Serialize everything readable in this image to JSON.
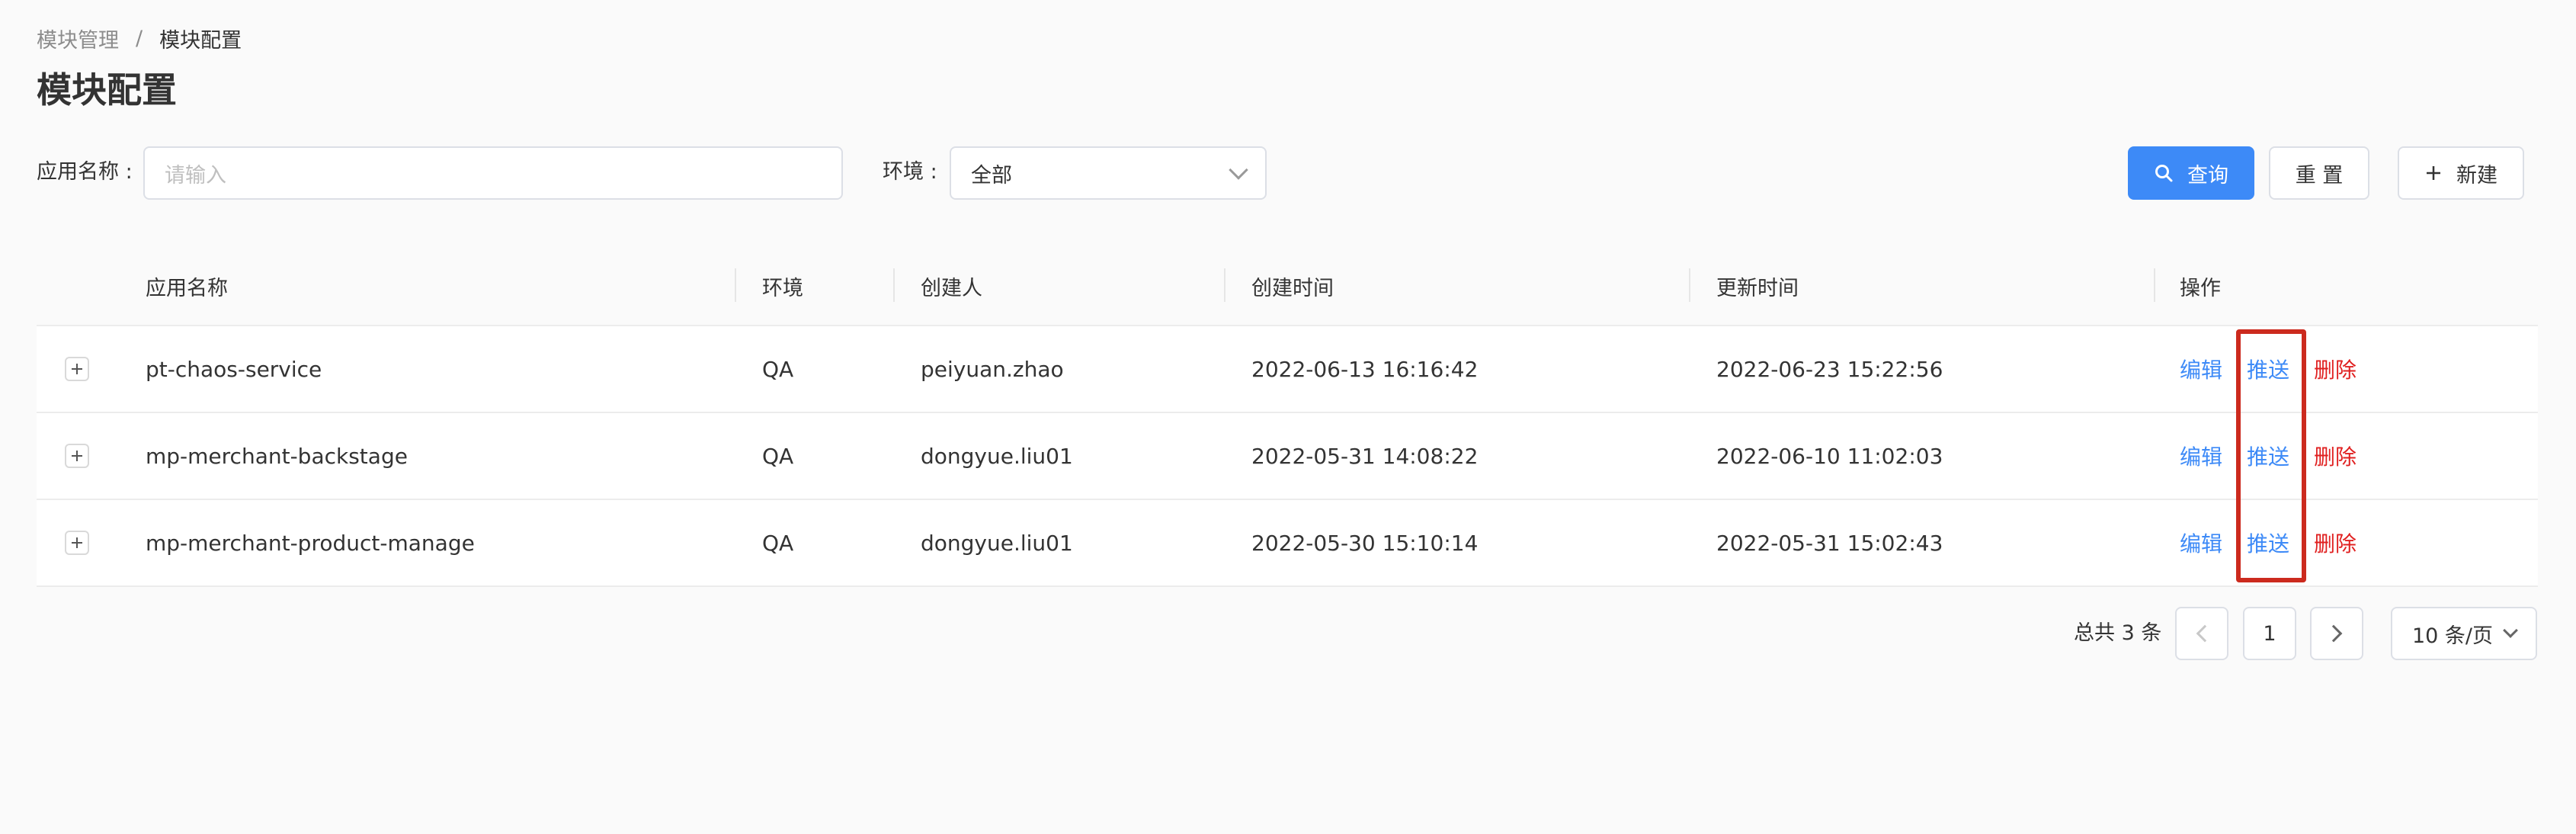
{
  "breadcrumb": {
    "parent": "模块管理",
    "separator": "/",
    "current": "模块配置"
  },
  "page": {
    "title": "模块配置"
  },
  "filters": {
    "app_name_label": "应用名称 :",
    "app_name_placeholder": "请输入",
    "env_label": "环境 :",
    "env_value": "全部"
  },
  "toolbar": {
    "query_label": "查询",
    "reset_label": "重 置",
    "new_label": "新建"
  },
  "table": {
    "columns": [
      "应用名称",
      "环境",
      "创建人",
      "创建时间",
      "更新时间",
      "操作"
    ],
    "rows": [
      {
        "app": "pt-chaos-service",
        "env": "QA",
        "creator": "peiyuan.zhao",
        "created": "2022-06-13 16:16:42",
        "updated": "2022-06-23 15:22:56"
      },
      {
        "app": "mp-merchant-backstage",
        "env": "QA",
        "creator": "dongyue.liu01",
        "created": "2022-05-31 14:08:22",
        "updated": "2022-06-10 11:02:03"
      },
      {
        "app": "mp-merchant-product-manage",
        "env": "QA",
        "creator": "dongyue.liu01",
        "created": "2022-05-30 15:10:14",
        "updated": "2022-05-31 15:02:43"
      }
    ],
    "actions": {
      "edit": "编辑",
      "push": "推送",
      "delete": "删除"
    }
  },
  "pagination": {
    "total_text": "总共 3 条",
    "current_page": "1",
    "page_size": "10 条/页"
  },
  "colors": {
    "primary": "#3d8af7",
    "danger": "#e02020",
    "highlight": "#cc2a1e"
  },
  "icons": {
    "search": "search-icon",
    "plus": "plus-icon",
    "expand": "expand-plus-icon",
    "chevron": "chevron-down-icon"
  }
}
